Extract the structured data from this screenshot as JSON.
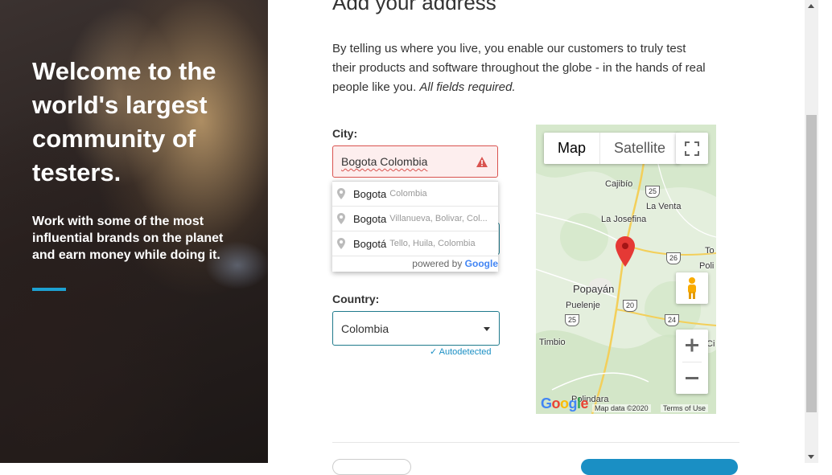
{
  "hero": {
    "title": "Welcome to the world's largest community of testers.",
    "subtitle": "Work with some of the most influential brands on the planet and earn money while doing it."
  },
  "main": {
    "heading": "Add your address",
    "intro": "By telling us where you live, you enable our customers to truly test their products and software throughout the globe - in the hands of real people like you.",
    "intro_emphasis": "All fields required.",
    "city": {
      "label": "City:",
      "value": "Bogota Colombia",
      "error_icon": "warning-icon",
      "suggestions": [
        {
          "main": "Bogota",
          "secondary": "Colombia"
        },
        {
          "main": "Bogota",
          "secondary": "Villanueva, Bolivar, Col..."
        },
        {
          "main": "Bogotá",
          "secondary": "Tello, Huila, Colombia"
        }
      ],
      "powered_by_prefix": "powered by ",
      "powered_by_brand": "Google"
    },
    "country": {
      "label": "Country:",
      "value": "Colombia",
      "autodetected": "Autodetected"
    }
  },
  "map": {
    "type_map": "Map",
    "type_satellite": "Satellite",
    "places": [
      "Cajibío",
      "La Venta",
      "La Josefina",
      "Popayán",
      "Puelenje",
      "Timbio",
      "Polindara",
      "To",
      "Poli",
      "Ci"
    ],
    "routes": [
      "25",
      "26",
      "20",
      "25",
      "24"
    ],
    "map_data": "Map data ©2020",
    "terms": "Terms of Use",
    "logo": "Google",
    "pin_color": "#e53935"
  },
  "colors": {
    "accent": "#1da1d2",
    "error": "#d9534f",
    "field_border": "#1f7a8c",
    "link": "#1a8fc4"
  }
}
